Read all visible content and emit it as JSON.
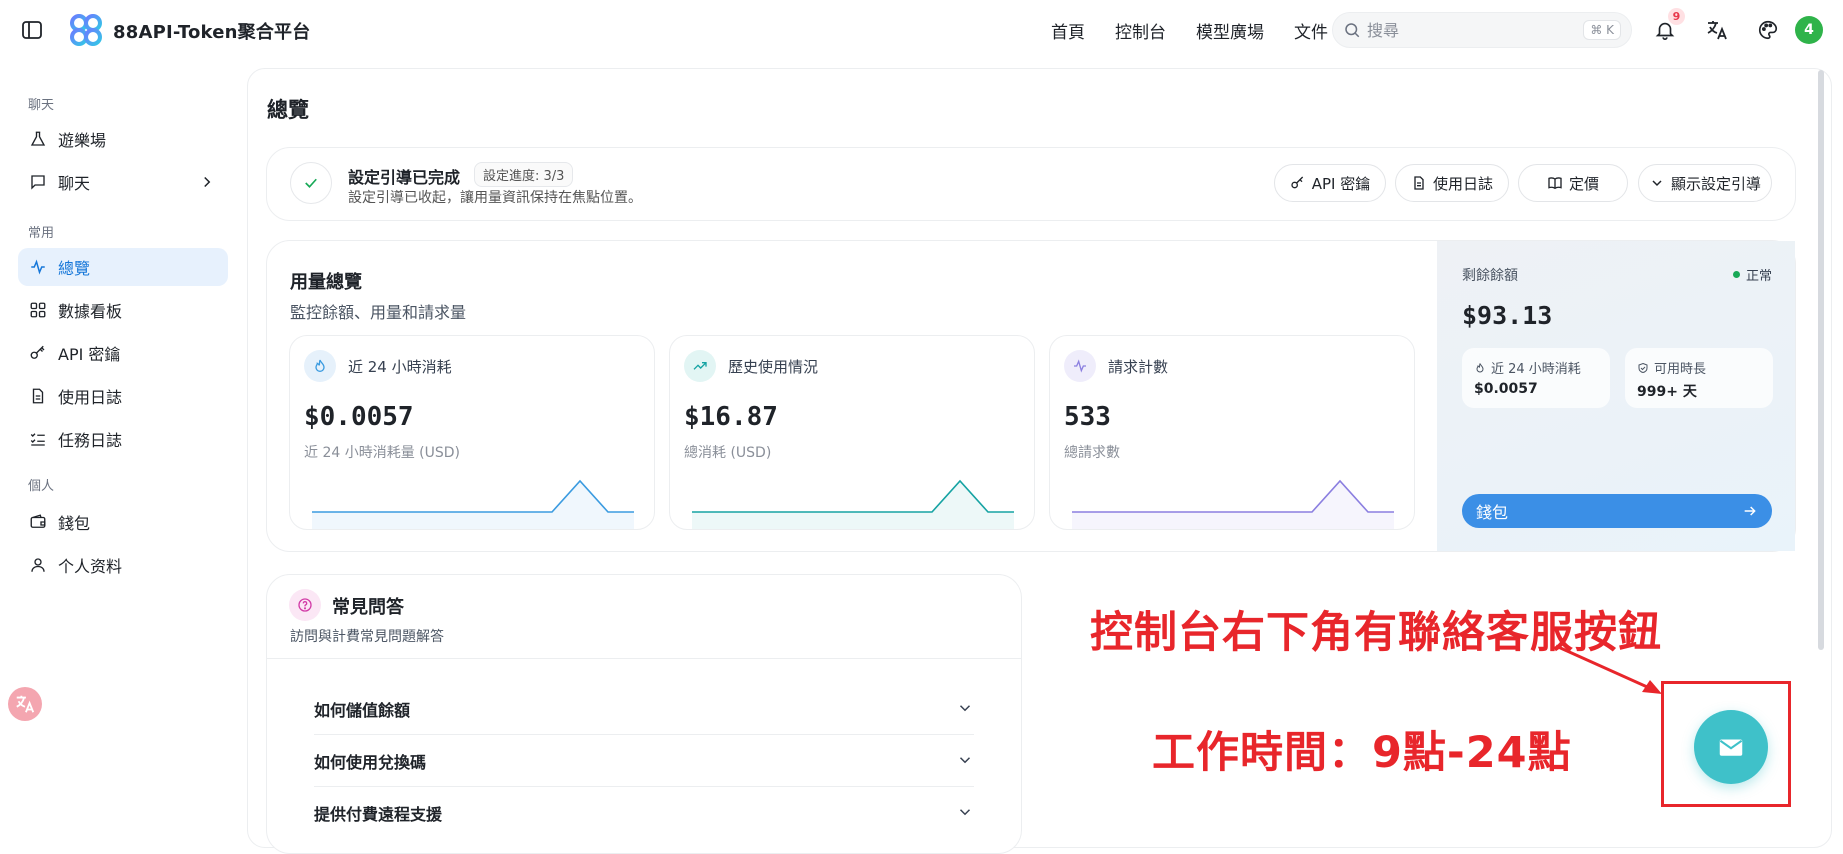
{
  "app": {
    "brand": "88API-Token聚合平台"
  },
  "topnav": {
    "items": [
      "首頁",
      "控制台",
      "模型廣場",
      "文件"
    ]
  },
  "search": {
    "placeholder": "搜尋",
    "shortcut": "⌘ K"
  },
  "notifications": {
    "count": "9"
  },
  "user": {
    "avatar_text": "4",
    "avatar_color": "#2fb34a"
  },
  "sidebar": {
    "sections": [
      {
        "label": "聊天"
      },
      {
        "label": "常用"
      },
      {
        "label": "個人"
      }
    ],
    "items": [
      {
        "label": "遊樂場",
        "icon": "flask-icon"
      },
      {
        "label": "聊天",
        "icon": "chat-icon"
      },
      {
        "label": "總覽",
        "icon": "activity-icon",
        "active": true
      },
      {
        "label": "數據看板",
        "icon": "grid-icon"
      },
      {
        "label": "API 密鑰",
        "icon": "key-icon"
      },
      {
        "label": "使用日誌",
        "icon": "document-icon"
      },
      {
        "label": "任務日誌",
        "icon": "list-check-icon"
      },
      {
        "label": "錢包",
        "icon": "wallet-icon"
      },
      {
        "label": "个人资料",
        "icon": "user-icon"
      }
    ]
  },
  "page": {
    "title": "總覽"
  },
  "setup": {
    "title": "設定引導已完成",
    "progress": "設定進度: 3/3",
    "subtitle": "設定引導已收起，讓用量資訊保持在焦點位置。",
    "buttons": {
      "api_keys": "API 密鑰",
      "usage_logs": "使用日誌",
      "pricing": "定價",
      "show_guide": "顯示設定引導"
    }
  },
  "usage": {
    "title": "用量總覽",
    "subtitle": "監控餘額、用量和請求量",
    "metrics": [
      {
        "label": "近 24 小時消耗",
        "value": "$0.0057",
        "sub": "近 24 小時消耗量 (USD)",
        "color": "#3b9be0"
      },
      {
        "label": "歷史使用情況",
        "value": "$16.87",
        "sub": "總消耗 (USD)",
        "color": "#16a3a3"
      },
      {
        "label": "請求計數",
        "value": "533",
        "sub": "總請求數",
        "color": "#8b7fe0"
      }
    ]
  },
  "balance": {
    "label": "剩餘餘額",
    "status": "正常",
    "value": "$93.13",
    "consumption_label": "近 24 小時消耗",
    "consumption_value": "$0.0057",
    "duration_label": "可用時長",
    "duration_value": "999+ 天",
    "wallet_button": "錢包"
  },
  "faq": {
    "title": "常見問答",
    "subtitle": "訪問與計費常見問題解答",
    "items": [
      "如何儲值餘額",
      "如何使用兌換碼",
      "提供付費遠程支援"
    ]
  },
  "annotation": {
    "line1": "控制台右下角有聯絡客服按鈕",
    "line2": "工作時間：9點-24點",
    "color": "#e8262b"
  },
  "colors": {
    "accent": "#1677d9",
    "wallet_button": "#3b8fe6",
    "contact_button": "#3fc1c9"
  }
}
